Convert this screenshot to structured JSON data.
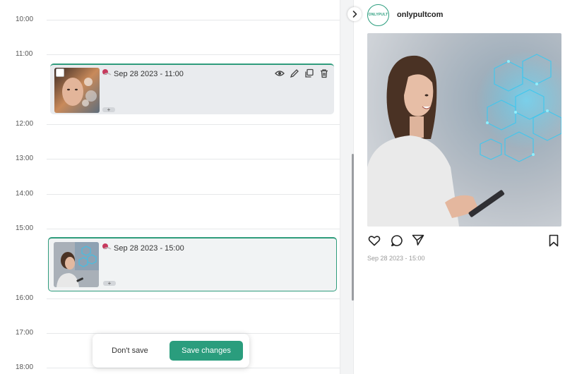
{
  "calendar": {
    "hours": [
      "10:00",
      "11:00",
      "12:00",
      "13:00",
      "14:00",
      "15:00",
      "16:00",
      "17:00",
      "18:00"
    ],
    "posts": [
      {
        "date_label": "Sep 28 2023 - 11:00",
        "selected": false
      },
      {
        "date_label": "Sep 28 2023 - 15:00",
        "selected": true
      }
    ],
    "accent_color": "#2f9c7c"
  },
  "save_bar": {
    "dont_save_label": "Don't save",
    "save_changes_label": "Save changes",
    "save_color": "#2a9d7d"
  },
  "preview": {
    "avatar_text": "ONLYPULT",
    "account_name": "onlypultcom",
    "post_date": "Sep 28 2023 - 15:00"
  },
  "icons": {
    "card_actions": [
      "eye-icon",
      "pencil-icon",
      "copy-icon",
      "trash-icon"
    ],
    "preview_actions": [
      "heart-icon",
      "comment-icon",
      "send-icon",
      "bookmark-icon"
    ]
  }
}
